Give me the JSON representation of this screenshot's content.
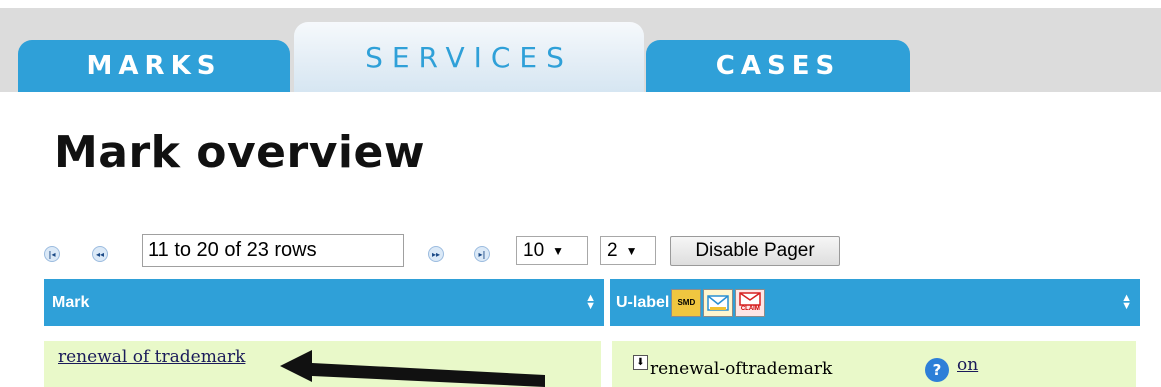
{
  "tabs": [
    {
      "label": "MARKS"
    },
    {
      "label": "SERVICES"
    },
    {
      "label": "CASES"
    }
  ],
  "page_title": "Mark overview",
  "pager": {
    "page_info": "11 to 20 of 23 rows",
    "page_size": "10",
    "page_number": "2",
    "disable_label": "Disable Pager"
  },
  "table": {
    "columns": [
      "Mark",
      "U-label"
    ],
    "badges": [
      "SMD",
      "",
      "CLAIM"
    ],
    "rows": [
      {
        "mark": "renewal of trademark",
        "ulabel": "renewal-oftrademark",
        "status": "on"
      }
    ]
  },
  "colors": {
    "accent": "#2fa0d8",
    "row_bg": "#e9f9c9"
  }
}
